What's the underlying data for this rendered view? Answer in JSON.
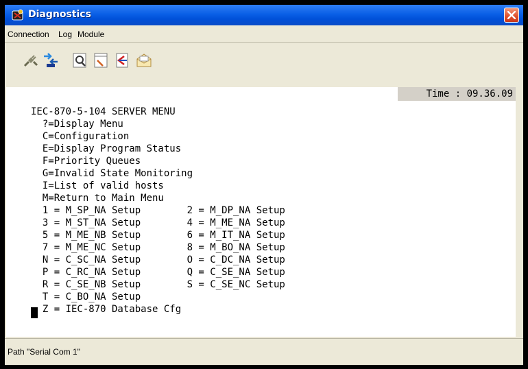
{
  "window": {
    "title": "Diagnostics"
  },
  "menubar": {
    "items": [
      "Connection",
      "Log",
      "Module"
    ]
  },
  "toolbar": {
    "buttons": [
      {
        "icon": "disconnect-plug-icon"
      },
      {
        "icon": "connect-arrows-icon"
      },
      {
        "icon": "magnifier-page-icon"
      },
      {
        "icon": "edit-page-icon"
      },
      {
        "icon": "transfer-page-icon"
      },
      {
        "icon": "envelope-icon"
      }
    ]
  },
  "terminal": {
    "time": "Time : 09.36.09",
    "lines": [
      "IEC-870-5-104 SERVER MENU",
      "  ?=Display Menu",
      "  C=Configuration",
      "  E=Display Program Status",
      "  F=Priority Queues",
      "  G=Invalid State Monitoring",
      "  I=List of valid hosts",
      "  M=Return to Main Menu",
      "  1 = M_SP_NA Setup        2 = M_DP_NA Setup",
      "  3 = M_ST_NA Setup        4 = M_ME_NA Setup",
      "  5 = M_ME_NB Setup        6 = M_IT_NA Setup",
      "  7 = M_ME_NC Setup        8 = M_BO_NA Setup",
      "  N = C_SC_NA Setup        O = C_DC_NA Setup",
      "  P = C_RC_NA Setup        Q = C_SE_NA Setup",
      "  R = C_SE_NB Setup        S = C_SE_NC Setup",
      "  T = C_BO_NA Setup",
      "  Z = IEC-870 Database Cfg"
    ]
  },
  "status": {
    "path": "Path \"Serial Com 1\""
  },
  "colors": {
    "titlebar": "#0a5fe6",
    "client": "#ece9d8",
    "close": "#e0502c"
  }
}
